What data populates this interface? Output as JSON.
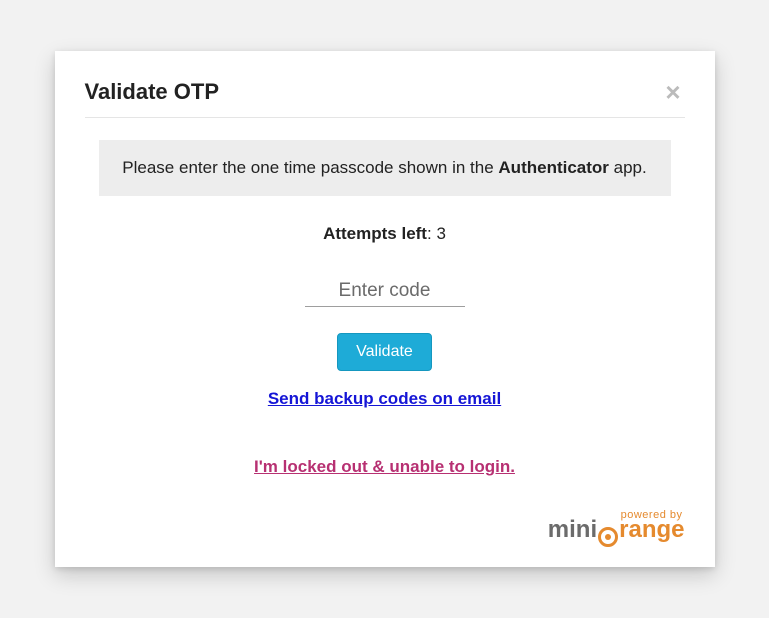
{
  "modal": {
    "title": "Validate OTP",
    "close_symbol": "×",
    "instruction_pre": "Please enter the one time passcode shown in the ",
    "instruction_strong": "Authenticator",
    "instruction_post": " app.",
    "attempts_label": "Attempts left",
    "attempts_value": "3",
    "code_placeholder": "Enter code",
    "validate_label": "Validate",
    "backup_link": "Send backup codes on email",
    "locked_link": "I'm locked out & unable to login.",
    "powered_by_top": "powered by",
    "logo_mini": "mini",
    "logo_range": "range"
  }
}
